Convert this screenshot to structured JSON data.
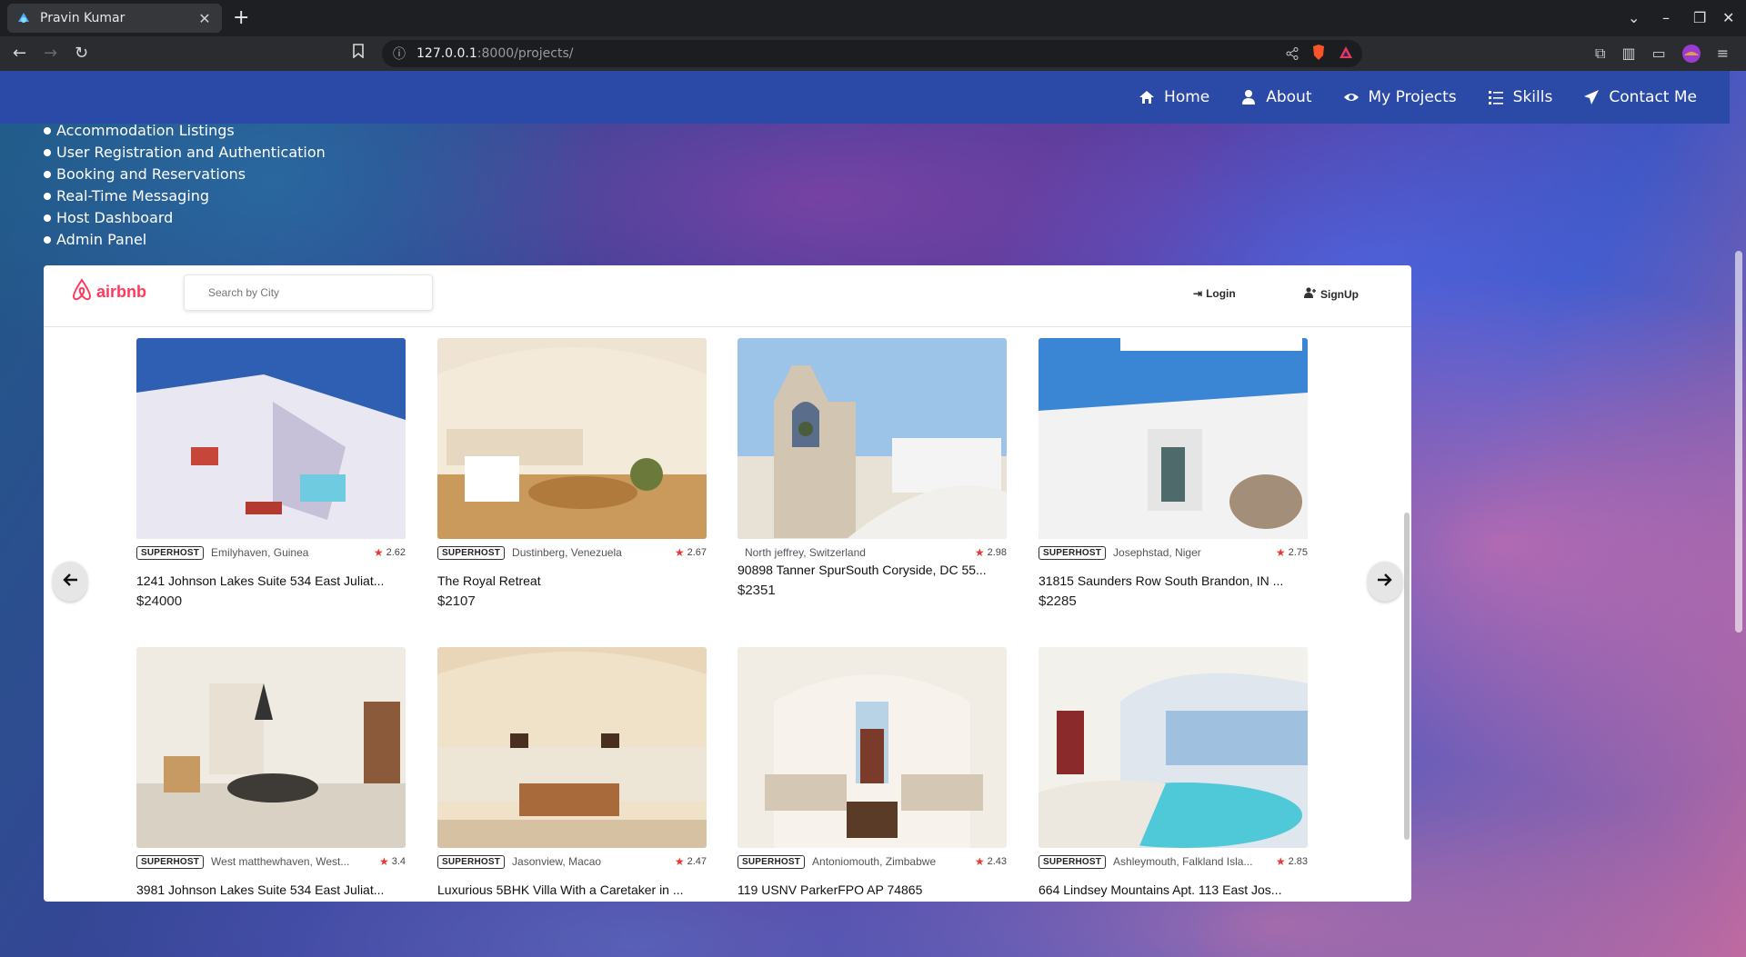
{
  "browser": {
    "tab_title": "Pravin Kumar",
    "url_host": "127.0.0.1",
    "url_path": ":8000/projects/"
  },
  "nav": {
    "items": [
      {
        "label": "Home",
        "icon": "home-icon"
      },
      {
        "label": "About",
        "icon": "user-icon"
      },
      {
        "label": "My Projects",
        "icon": "eye-icon"
      },
      {
        "label": "Skills",
        "icon": "list-icon"
      },
      {
        "label": "Contact Me",
        "icon": "paper-plane-icon"
      }
    ]
  },
  "features": [
    "Accommodation Listings",
    "User Registration and Authentication",
    "Booking and Reservations",
    "Real-Time Messaging",
    "Host Dashboard",
    "Admin Panel"
  ],
  "airbnb": {
    "logo_text": "airbnb",
    "search_placeholder": "Search by City",
    "login_label": "Login",
    "signup_label": "SignUp",
    "brand_color": "#ff385c",
    "listings": [
      {
        "superhost": true,
        "badge": "SUPERHOST",
        "location": "Emilyhaven, Guinea",
        "rating": "2.62",
        "title": "1241 Johnson Lakes Suite 534 East Juliat...",
        "price": "$24000"
      },
      {
        "superhost": true,
        "badge": "SUPERHOST",
        "location": "Dustinberg, Venezuela",
        "rating": "2.67",
        "title": "The Royal Retreat",
        "price": "$2107"
      },
      {
        "superhost": false,
        "badge": "",
        "location": "North jeffrey, Switzerland",
        "rating": "2.98",
        "title": "90898 Tanner SpurSouth Coryside, DC 55...",
        "price": "$2351"
      },
      {
        "superhost": true,
        "badge": "SUPERHOST",
        "location": "Josephstad, Niger",
        "rating": "2.75",
        "title": "31815 Saunders Row South Brandon, IN ...",
        "price": "$2285"
      },
      {
        "superhost": true,
        "badge": "SUPERHOST",
        "location": "West matthewhaven, West...",
        "rating": "3.4",
        "title": "3981 Johnson Lakes Suite 534 East Juliat...",
        "price": ""
      },
      {
        "superhost": true,
        "badge": "SUPERHOST",
        "location": "Jasonview, Macao",
        "rating": "2.47",
        "title": "Luxurious 5BHK Villa With a Caretaker in ...",
        "price": ""
      },
      {
        "superhost": true,
        "badge": "SUPERHOST",
        "location": "Antoniomouth, Zimbabwe",
        "rating": "2.43",
        "title": "119 USNV ParkerFPO AP 74865",
        "price": ""
      },
      {
        "superhost": true,
        "badge": "SUPERHOST",
        "location": "Ashleymouth, Falkland Isla...",
        "rating": "2.83",
        "title": "664 Lindsey Mountains Apt. 113 East Jos...",
        "price": ""
      }
    ]
  }
}
